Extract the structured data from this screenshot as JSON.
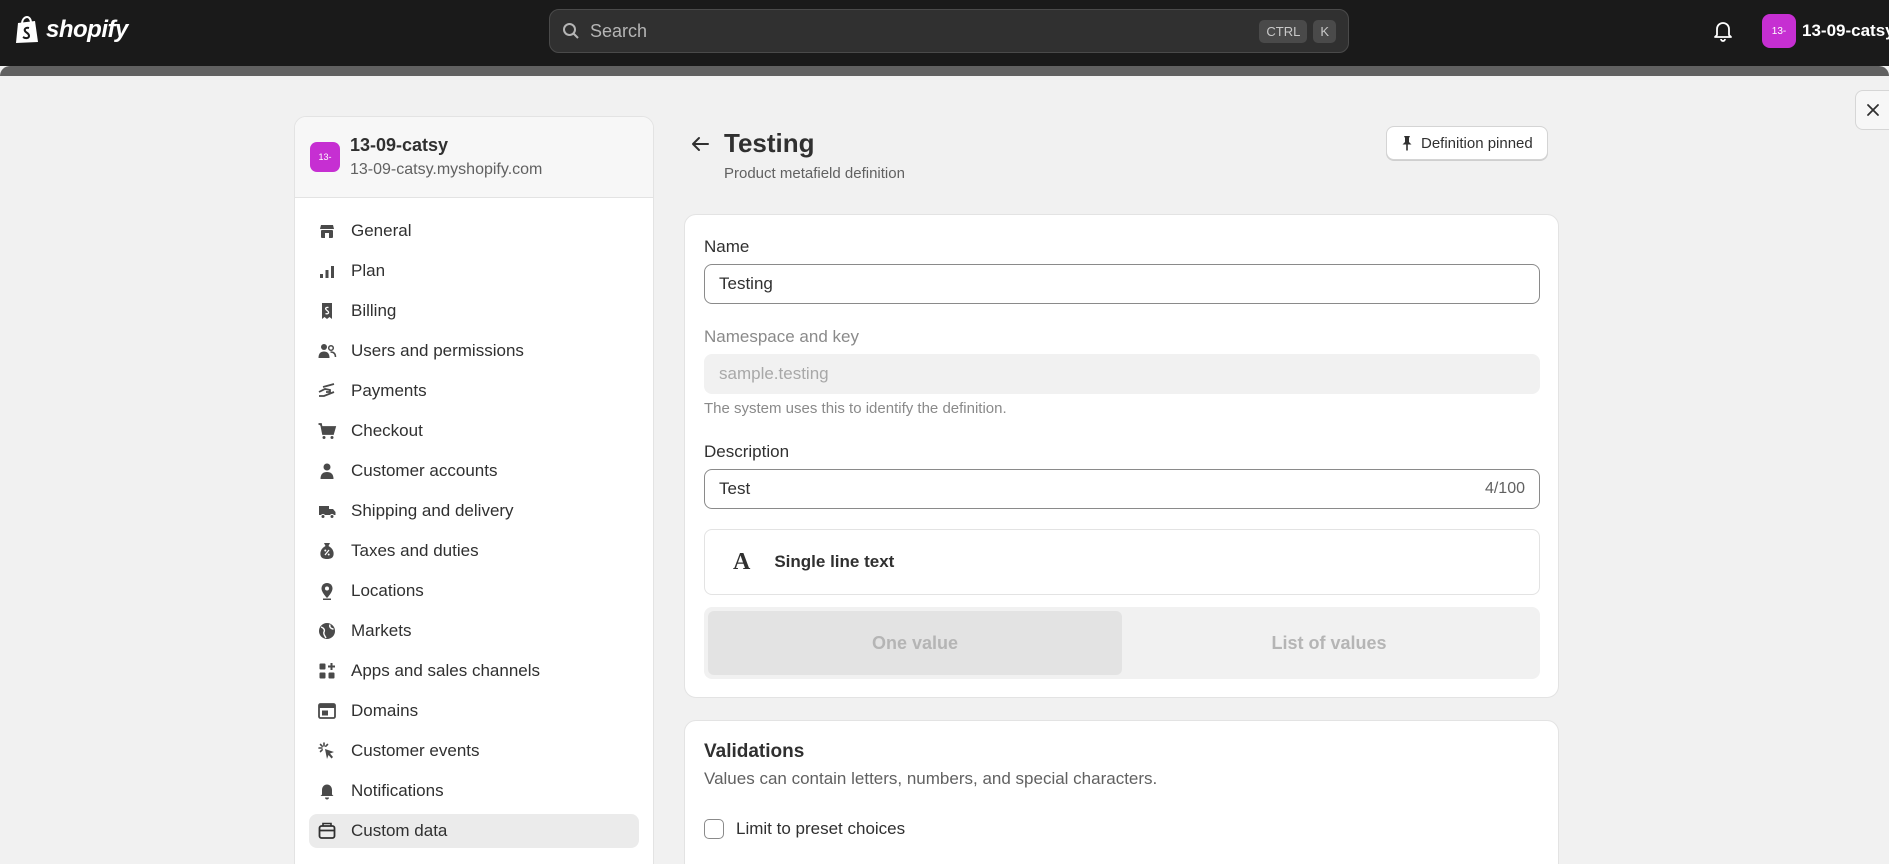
{
  "topbar": {
    "brand": "shopify",
    "search_placeholder": "Search",
    "shortcut_key1": "CTRL",
    "shortcut_key2": "K",
    "account_initials": "13-",
    "account_name": "13-09-catsy"
  },
  "sidebar": {
    "store_initials": "13-",
    "store_name": "13-09-catsy",
    "store_domain": "13-09-catsy.myshopify.com",
    "items": [
      {
        "label": "General",
        "icon": "store-icon"
      },
      {
        "label": "Plan",
        "icon": "plan-icon"
      },
      {
        "label": "Billing",
        "icon": "receipt-icon"
      },
      {
        "label": "Users and permissions",
        "icon": "users-icon"
      },
      {
        "label": "Payments",
        "icon": "payments-icon"
      },
      {
        "label": "Checkout",
        "icon": "cart-icon"
      },
      {
        "label": "Customer accounts",
        "icon": "person-icon"
      },
      {
        "label": "Shipping and delivery",
        "icon": "truck-icon"
      },
      {
        "label": "Taxes and duties",
        "icon": "tax-icon"
      },
      {
        "label": "Locations",
        "icon": "location-icon"
      },
      {
        "label": "Markets",
        "icon": "globe-icon"
      },
      {
        "label": "Apps and sales channels",
        "icon": "apps-icon"
      },
      {
        "label": "Domains",
        "icon": "domains-icon"
      },
      {
        "label": "Customer events",
        "icon": "cursor-icon"
      },
      {
        "label": "Notifications",
        "icon": "bell-icon"
      },
      {
        "label": "Custom data",
        "icon": "custom-data-icon",
        "active": true
      }
    ]
  },
  "page": {
    "title": "Testing",
    "subtitle": "Product metafield definition",
    "pin_button": "Definition pinned"
  },
  "form": {
    "name_label": "Name",
    "name_value": "Testing",
    "namespace_label": "Namespace and key",
    "namespace_value": "sample.testing",
    "namespace_help": "The system uses this to identify the definition.",
    "description_label": "Description",
    "description_value": "Test",
    "description_counter": "4/100",
    "type_glyph": "A",
    "type_label": "Single line text",
    "one_value": "One value",
    "list_values": "List of values"
  },
  "validations": {
    "title": "Validations",
    "description": "Values can contain letters, numbers, and special characters.",
    "preset_label": "Limit to preset choices"
  },
  "colors": {
    "topbar": "#1a1a1a",
    "avatar": "#c62fd2",
    "page_bg": "#f1f1f1"
  }
}
